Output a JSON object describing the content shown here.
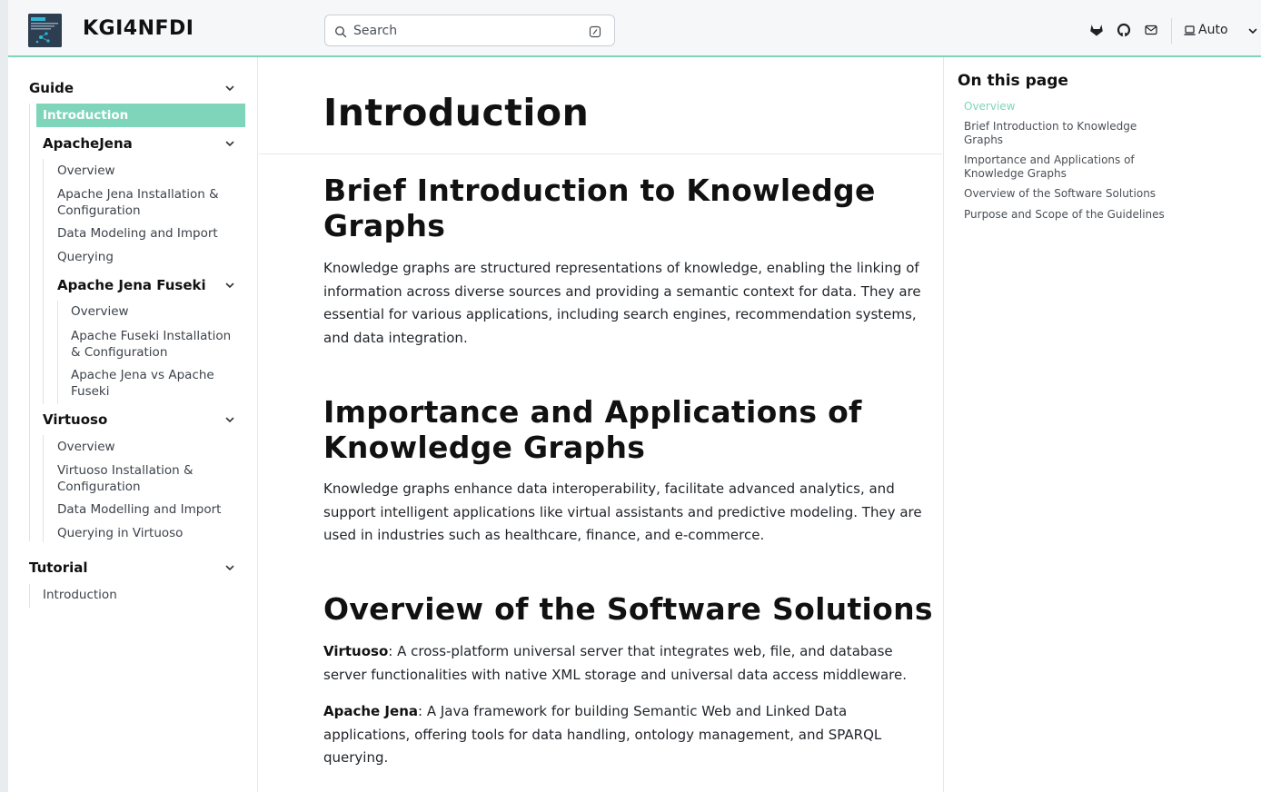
{
  "header": {
    "logo_text": "KGI4NFDI",
    "site_title": "KGI4NFDI",
    "search_placeholder": "Search",
    "icons": [
      "gitlab-icon",
      "github-icon",
      "mail-icon"
    ],
    "theme_label": "Auto"
  },
  "sidebar": {
    "guide": "Guide",
    "introduction": "Introduction",
    "apachejena": "ApacheJena",
    "aj_overview": "Overview",
    "aj_install": "Apache Jena Installation & Configuration",
    "aj_modeling": "Data Modeling and Import",
    "aj_querying": "Querying",
    "fuseki": "Apache Jena Fuseki",
    "fu_overview": "Overview",
    "fu_install": "Apache Fuseki Installation & Configuration",
    "fu_vs": "Apache Jena vs Apache Fuseki",
    "virtuoso": "Virtuoso",
    "vi_overview": "Overview",
    "vi_install": "Virtuoso Installation & Configuration",
    "vi_modelling": "Data Modelling and Import",
    "vi_querying": "Querying in Virtuoso",
    "tutorial": "Tutorial",
    "tu_intro": "Introduction"
  },
  "main": {
    "title": "Introduction",
    "s1_title": "Brief Introduction to Knowledge Graphs",
    "s1_text": "Knowledge graphs are structured representations of knowledge, enabling the linking of information across diverse sources and providing a semantic context for data. They are essential for various applications, including search engines, recommendation systems, and data integration.",
    "s2_title": "Importance and Applications of Knowledge Graphs",
    "s2_text": "Knowledge graphs enhance data interoperability, facilitate advanced analytics, and support intelligent applications like virtual assistants and predictive modeling. They are used in industries such as healthcare, finance, and e-commerce.",
    "s3_title": "Overview of the Software Solutions",
    "s3_p1_term": "Virtuoso",
    "s3_p1_text": ": A cross-platform universal server that integrates web, file, and database server functionalities with native XML storage and universal data access middleware.",
    "s3_p2_term": "Apache Jena",
    "s3_p2_text": ": A Java framework for building Semantic Web and Linked Data applications, offering tools for data handling, ontology management, and SPARQL querying."
  },
  "toc": {
    "title": "On this page",
    "items": [
      "Overview",
      "Brief Introduction to Knowledge Graphs",
      "Importance and Applications of Knowledge Graphs",
      "Overview of the Software Solutions",
      "Purpose and Scope of the Guidelines"
    ]
  },
  "colors": {
    "accent": "#7fd5b9",
    "header_bg": "#f6f7f8"
  }
}
